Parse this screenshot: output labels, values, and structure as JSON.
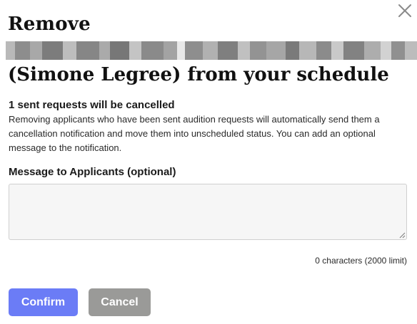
{
  "dialog": {
    "title_prefix": "Remove",
    "title_suffix": "(Simone Legree) from your schedule",
    "close_icon": "close-icon",
    "count_heading": "1 sent requests will be cancelled",
    "description": "Removing applicants who have been sent audition requests will automatically send them a cancellation notification and move them into unscheduled status. You can add an optional message to the notification.",
    "message_label": "Message to Applicants (optional)",
    "message_value": "",
    "char_count": "0 characters (2000 limit)",
    "confirm_label": "Confirm",
    "cancel_label": "Cancel"
  },
  "colors": {
    "confirm": "#6b7cf6",
    "cancel": "#9a9a98",
    "field_bg": "#f6f6f6"
  }
}
